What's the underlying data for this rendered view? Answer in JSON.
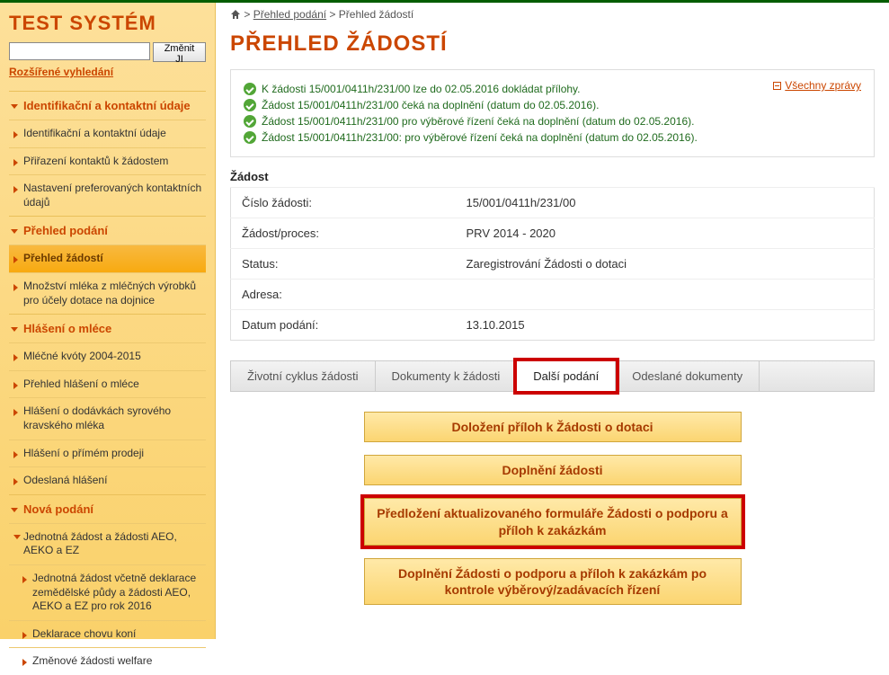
{
  "app": {
    "title": "TEST SYSTÉM"
  },
  "search": {
    "placeholder": "",
    "btn": "Změnit JI",
    "adv": "Rozšířené vyhledání"
  },
  "nav": {
    "s1": {
      "title": "Identifikační a kontaktní údaje",
      "i1": "Identifikační a kontaktní údaje",
      "i2": "Přiřazení kontaktů k žádostem",
      "i3": "Nastavení preferovaných kontaktních údajů"
    },
    "s2": {
      "title": "Přehled podání",
      "i1": "Přehled žádostí",
      "i2": "Množství mléka z mléčných výrobků pro účely dotace na dojnice"
    },
    "s3": {
      "title": "Hlášení o mléce",
      "i1": "Mléčné kvóty 2004-2015",
      "i2": "Přehled hlášení o mléce",
      "i3": "Hlášení o dodávkách syrového kravského mléka",
      "i4": "Hlášení o přímém prodeji",
      "i5": "Odeslaná hlášení"
    },
    "s4": {
      "title": "Nová podání",
      "i1": "Jednotná žádost a žádosti AEO, AEKO a EZ",
      "i1a": "Jednotná žádost včetně deklarace zemědělské půdy a žádosti AEO, AEKO a EZ pro rok 2016",
      "i1b": "Deklarace chovu koní",
      "i1c": "Změnové žádosti welfare"
    }
  },
  "breadcrumb": {
    "link1": "Přehled podání",
    "current": "Přehled žádostí"
  },
  "page": {
    "title": "PŘEHLED ŽÁDOSTÍ"
  },
  "messages": {
    "all": "Všechny zprávy",
    "m1": "K žádosti 15/001/0411h/231/00       lze do 02.05.2016 dokládat přílohy.",
    "m2": "Žádost 15/001/0411h/231/00       čeká na doplnění (datum do 02.05.2016).",
    "m3": "Žádost 15/001/0411h/231/00       pro výběrové řízení čeká na doplnění (datum do 02.05.2016).",
    "m4": "Žádost 15/001/0411h/231/00:      pro výběrové řízení čeká na doplnění (datum do 02.05.2016)."
  },
  "request": {
    "label": "Žádost",
    "r1k": "Číslo žádosti:",
    "r1v": "15/001/0411h/231/00",
    "r2k": "Žádost/proces:",
    "r2v": "PRV 2014 - 2020",
    "r3k": "Status:",
    "r3v": "Zaregistrování Žádosti o dotaci",
    "r4k": "Adresa:",
    "r4v": "",
    "r5k": "Datum podání:",
    "r5v": "13.10.2015"
  },
  "tabs": {
    "t1": "Životní cyklus žádosti",
    "t2": "Dokumenty k žádosti",
    "t3": "Další podání",
    "t4": "Odeslané dokumenty"
  },
  "actions": {
    "a1": "Doložení příloh k Žádosti o dotaci",
    "a2": "Doplnění žádosti",
    "a3": "Předložení aktualizovaného formuláře Žádosti o podporu a příloh k zakázkám",
    "a4": "Doplnění Žádosti o podporu a příloh k zakázkám po kontrole výběrový/zadávacích řízení"
  }
}
